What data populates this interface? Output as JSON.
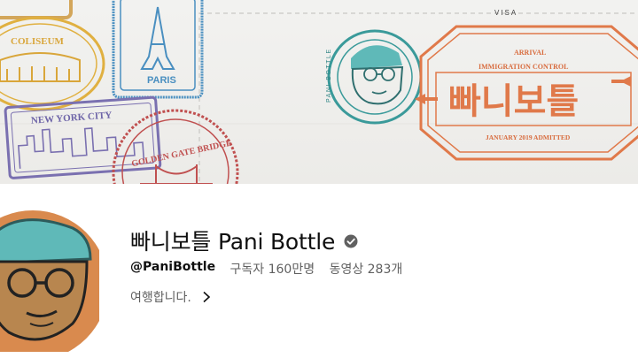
{
  "banner": {
    "stamps": {
      "coliseum": "COLISEUM",
      "paris": "PARIS",
      "newyork": "NEW YORK CITY",
      "goldengate": "GOLDEN GATE BRIDGE",
      "visa": "VISA",
      "circle": "PANI BOTTLE",
      "arrival": "ARRIVAL",
      "immigration": "IMMIGRATION CONTROL",
      "korean_name": "빠니보틀",
      "admitted": "JANUARY 2019 ADMITTED"
    }
  },
  "channel": {
    "name": "빠니보틀 Pani Bottle",
    "handle": "@PaniBottle",
    "subscribers": "구독자 160만명",
    "videos": "동영상 283개",
    "description": "여행합니다."
  },
  "colors": {
    "stamp_orange": "#e0794a",
    "stamp_teal": "#3a9a9a",
    "stamp_blue": "#4a8fc0",
    "stamp_yellow": "#e0b040",
    "stamp_purple": "#7a70b0",
    "stamp_red": "#c05050"
  }
}
